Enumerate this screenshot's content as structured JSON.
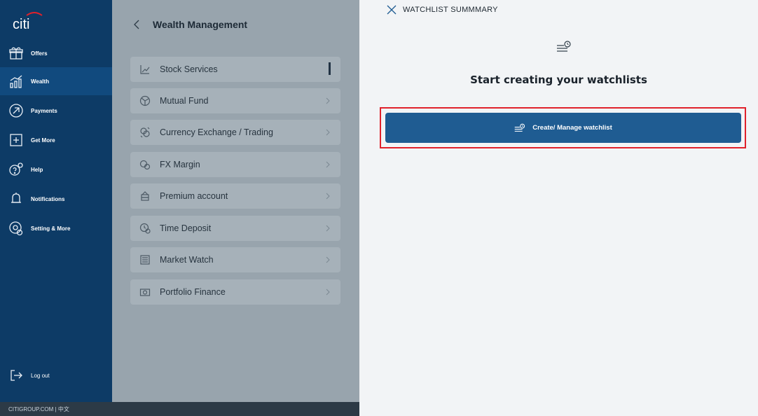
{
  "nav": {
    "items": [
      {
        "label": "Offers",
        "icon": "gift-icon"
      },
      {
        "label": "Wealth",
        "icon": "chart-icon"
      },
      {
        "label": "Payments",
        "icon": "arrow-circle-icon"
      },
      {
        "label": "Get More",
        "icon": "plus-box-icon"
      },
      {
        "label": "Help",
        "icon": "help-icon"
      },
      {
        "label": "Notifications",
        "icon": "bell-icon"
      },
      {
        "label": "Setting & More",
        "icon": "settings-icon"
      }
    ],
    "active_item": "Wealth",
    "logout_label": "Log out"
  },
  "footer": {
    "text": "CITIGROUP.COM  |  中文"
  },
  "panel": {
    "title": "Wealth Management",
    "items": [
      {
        "label": "Stock Services",
        "icon": "line-chart-icon"
      },
      {
        "label": "Mutual Fund",
        "icon": "pie-icon"
      },
      {
        "label": "Currency Exchange / Trading",
        "icon": "currency-exchange-icon"
      },
      {
        "label": "FX Margin",
        "icon": "fx-margin-icon"
      },
      {
        "label": "Premium account",
        "icon": "premium-icon"
      },
      {
        "label": "Time Deposit",
        "icon": "time-deposit-icon"
      },
      {
        "label": "Market Watch",
        "icon": "market-watch-icon"
      },
      {
        "label": "Portfolio Finance",
        "icon": "portfolio-icon"
      }
    ]
  },
  "watchlist": {
    "header": "WATCHLIST SUMMMARY",
    "headline": "Start creating your watchlists",
    "button_label": "Create/ Manage watchlist"
  },
  "colors": {
    "nav_bg": "#0d3b66",
    "button_bg": "#1f5c92",
    "highlight": "#e0212b"
  }
}
